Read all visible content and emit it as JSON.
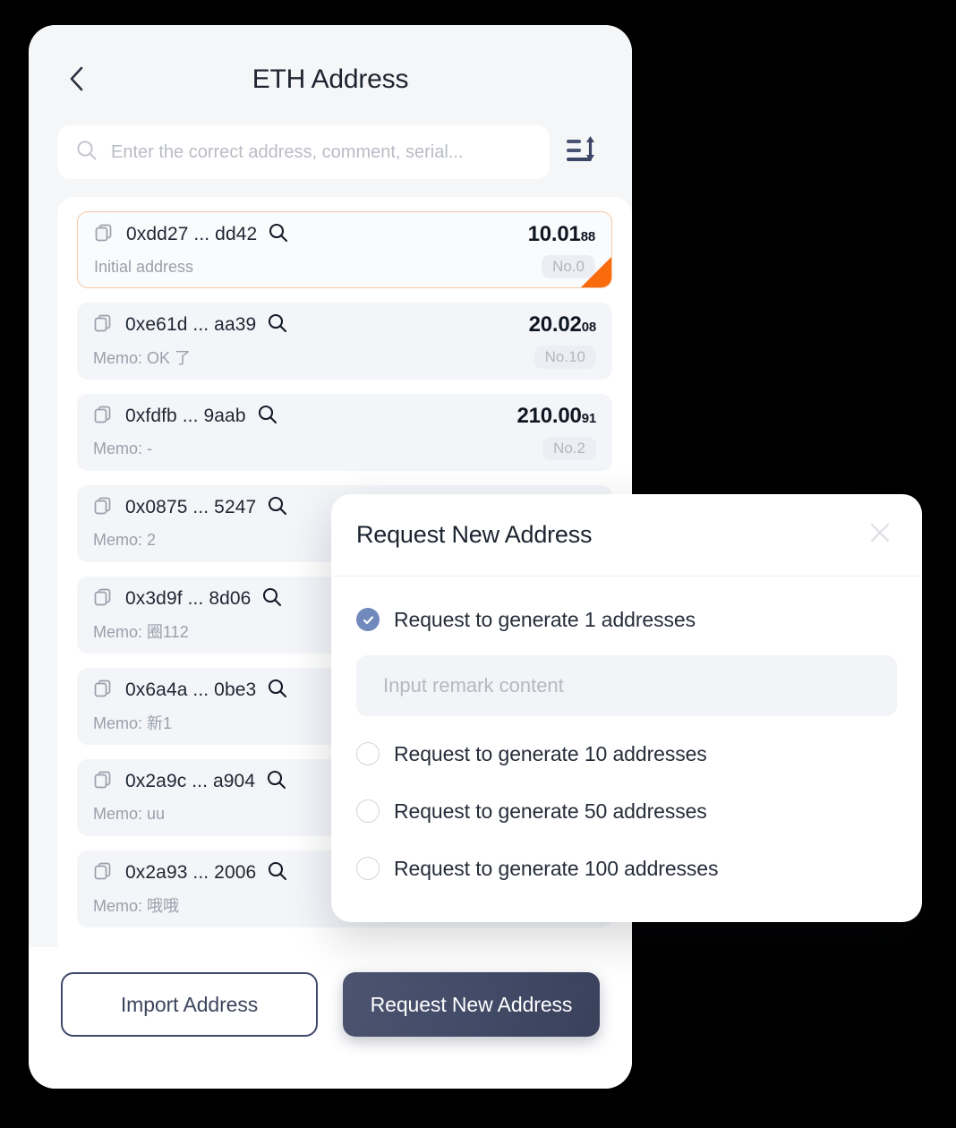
{
  "phone": {
    "back_icon": "chevron-left-icon",
    "title": "ETH Address",
    "search": {
      "icon": "search-icon",
      "placeholder": "Enter the correct address, comment, serial...",
      "value": ""
    },
    "sort_icon": "sort-lines-icon",
    "addresses": [
      {
        "copy_icon": "copy-icon",
        "address": "0xdd27 ... dd42",
        "zoom_icon": "magnifier-icon",
        "amount_main": "10.01",
        "amount_dec": "88",
        "memo": "Initial address",
        "serial": "No.0",
        "highlighted": true
      },
      {
        "copy_icon": "copy-icon",
        "address": "0xe61d ... aa39",
        "zoom_icon": "magnifier-icon",
        "amount_main": "20.02",
        "amount_dec": "08",
        "memo": "Memo: OK 了",
        "serial": "No.10",
        "highlighted": false
      },
      {
        "copy_icon": "copy-icon",
        "address": "0xfdfb ... 9aab",
        "zoom_icon": "magnifier-icon",
        "amount_main": "210.00",
        "amount_dec": "91",
        "memo": "Memo: -",
        "serial": "No.2",
        "highlighted": false
      },
      {
        "copy_icon": "copy-icon",
        "address": "0x0875 ... 5247",
        "zoom_icon": "magnifier-icon",
        "amount_main": "",
        "amount_dec": "",
        "memo": "Memo: 2",
        "serial": "",
        "highlighted": false
      },
      {
        "copy_icon": "copy-icon",
        "address": "0x3d9f ... 8d06",
        "zoom_icon": "magnifier-icon",
        "amount_main": "",
        "amount_dec": "",
        "memo": "Memo: 圈112",
        "serial": "",
        "highlighted": false
      },
      {
        "copy_icon": "copy-icon",
        "address": "0x6a4a ... 0be3",
        "zoom_icon": "magnifier-icon",
        "amount_main": "",
        "amount_dec": "",
        "memo": "Memo: 新1",
        "serial": "",
        "highlighted": false
      },
      {
        "copy_icon": "copy-icon",
        "address": "0x2a9c ... a904",
        "zoom_icon": "magnifier-icon",
        "amount_main": "",
        "amount_dec": "",
        "memo": "Memo: uu",
        "serial": "",
        "highlighted": false
      },
      {
        "copy_icon": "copy-icon",
        "address": "0x2a93 ... 2006",
        "zoom_icon": "magnifier-icon",
        "amount_main": "",
        "amount_dec": "",
        "memo": "Memo: 哦哦",
        "serial": "",
        "highlighted": false
      }
    ],
    "footer": {
      "import_label": "Import Address",
      "request_label": "Request New Address"
    }
  },
  "modal": {
    "title": "Request New Address",
    "close_icon": "close-icon",
    "options": [
      {
        "label": "Request to generate 1 addresses",
        "checked": true
      },
      {
        "label": "Request to generate 10 addresses",
        "checked": false
      },
      {
        "label": "Request to generate 50 addresses",
        "checked": false
      },
      {
        "label": "Request to generate 100 addresses",
        "checked": false
      }
    ],
    "remark": {
      "placeholder": "Input remark content",
      "value": ""
    }
  },
  "colors": {
    "background": "#000000",
    "phone_bg": "#f5f6f8",
    "list_bg": "#ffffff",
    "item_bg": "#f3f5f9",
    "accent_orange": "#f96a0d",
    "highlight_border": "#f5c9a8",
    "primary_button": "#414a66",
    "radio_checked": "#7189bd",
    "text_primary": "#1f2632",
    "text_muted": "#9aa0ab"
  }
}
